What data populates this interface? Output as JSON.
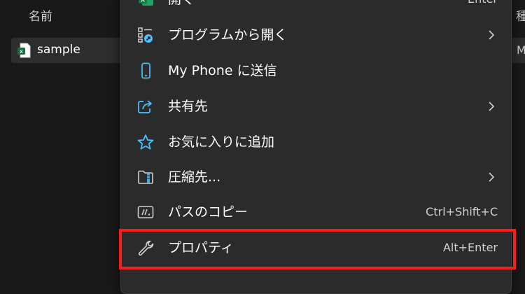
{
  "explorer": {
    "column_header_name": "名前",
    "column_header_right": "種",
    "file": {
      "name": "sample",
      "icon": "excel-file-icon"
    },
    "right_column_value": "M"
  },
  "context_menu": {
    "items": [
      {
        "label": "開く",
        "shortcut": "Enter",
        "icon": "excel-icon",
        "submenu": false
      },
      {
        "label": "プログラムから開く",
        "shortcut": "",
        "icon": "open-with-icon",
        "submenu": true
      },
      {
        "label": "My Phone に送信",
        "shortcut": "",
        "icon": "phone-icon",
        "submenu": false
      },
      {
        "label": "共有先",
        "shortcut": "",
        "icon": "share-icon",
        "submenu": true
      },
      {
        "label": "お気に入りに追加",
        "shortcut": "",
        "icon": "star-icon",
        "submenu": false
      },
      {
        "label": "圧縮先...",
        "shortcut": "",
        "icon": "zip-folder-icon",
        "submenu": true
      },
      {
        "label": "パスのコピー",
        "shortcut": "Ctrl+Shift+C",
        "icon": "copy-path-icon",
        "submenu": false
      },
      {
        "label": "プロパティ",
        "shortcut": "Alt+Enter",
        "icon": "wrench-icon",
        "submenu": false
      }
    ]
  },
  "colors": {
    "menu_background": "#2b2b2b",
    "explorer_background": "#191919",
    "accent_blue": "#4cc2ff",
    "excel_green": "#1d6f42",
    "highlight_red": "#ff1a1a"
  }
}
